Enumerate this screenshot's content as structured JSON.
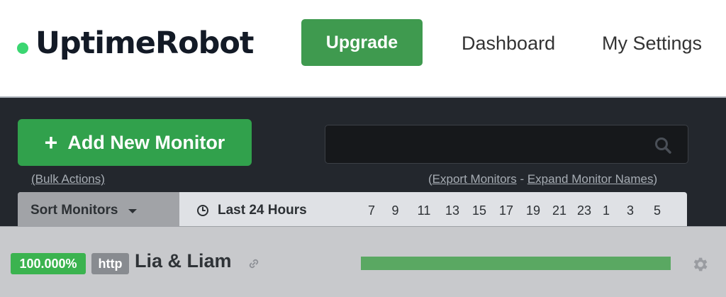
{
  "header": {
    "logo_text": "UptimeRobot",
    "upgrade_label": "Upgrade",
    "nav": {
      "dashboard": "Dashboard",
      "settings": "My Settings"
    }
  },
  "toolbar": {
    "add_label": "Add New Monitor",
    "add_icon": "plus-icon",
    "search_placeholder": "",
    "search_icon": "search-icon",
    "bulk_actions": "(Bulk Actions)",
    "export_monitors": "Export Monitors",
    "separator": " - ",
    "expand_names": "Expand Monitor Names"
  },
  "sortbar": {
    "sort_label": "Sort Monitors",
    "range_label": "Last 24 Hours",
    "hours": [
      "7",
      "9",
      "11",
      "13",
      "15",
      "17",
      "19",
      "21",
      "23",
      "1",
      "3",
      "5"
    ]
  },
  "monitors": [
    {
      "uptime": "100.000%",
      "type": "http",
      "name": "Lia & Liam",
      "uptime_fraction": 1.0,
      "status_color": "#5aa862"
    }
  ],
  "colors": {
    "brand_green": "#3bd671",
    "upgrade_green": "#3f9a4f",
    "add_green": "#31a14c",
    "panel_dark": "#23272d"
  }
}
